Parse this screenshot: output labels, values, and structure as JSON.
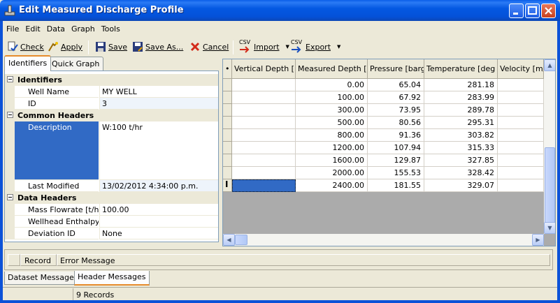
{
  "window": {
    "title": "Edit Measured Discharge Profile"
  },
  "menu": [
    "File",
    "Edit",
    "Data",
    "Graph",
    "Tools"
  ],
  "toolbar": {
    "check": "Check",
    "apply": "Apply",
    "save": "Save",
    "save_as": "Save As...",
    "cancel": "Cancel",
    "import": "Import",
    "export": "Export",
    "csv": "CSV"
  },
  "left_tabs": [
    "Identifiers",
    "Quick Graph"
  ],
  "properties": {
    "identifiers": {
      "label": "Identifiers",
      "well_name_label": "Well Name",
      "well_name": "MY WELL",
      "id_label": "ID",
      "id": "3"
    },
    "common": {
      "label": "Common Headers",
      "description_label": "Description",
      "description": "W:100 t/hr",
      "last_modified_label": "Last Modified",
      "last_modified": "13/02/2012 4:34:00 p.m."
    },
    "data_headers": {
      "label": "Data Headers",
      "mass_flowrate_label": "Mass Flowrate [t/hr",
      "mass_flowrate": "100.00",
      "wellhead_enthalpy_label": "Wellhead Enthalpy [",
      "wellhead_enthalpy": "",
      "deviation_label": "Deviation ID",
      "deviation": "None"
    }
  },
  "grid": {
    "row_marker": "•",
    "columns": [
      "Vertical Depth [m]",
      "Measured Depth [m]",
      "Pressure [barg]",
      "Temperature [deg C]",
      "Velocity [m/s]"
    ],
    "rows": [
      [
        "",
        "0.00",
        "65.04",
        "281.18",
        ""
      ],
      [
        "",
        "100.00",
        "67.92",
        "283.99",
        ""
      ],
      [
        "",
        "300.00",
        "73.95",
        "289.78",
        ""
      ],
      [
        "",
        "500.00",
        "80.56",
        "295.31",
        ""
      ],
      [
        "",
        "800.00",
        "91.36",
        "303.82",
        ""
      ],
      [
        "",
        "1200.00",
        "107.94",
        "315.33",
        ""
      ],
      [
        "",
        "1600.00",
        "129.87",
        "327.85",
        ""
      ],
      [
        "",
        "2000.00",
        "155.53",
        "328.42",
        ""
      ],
      [
        "",
        "2400.00",
        "181.55",
        "329.07",
        ""
      ]
    ],
    "editing_marker": "I"
  },
  "messages": {
    "col_record": "Record",
    "col_error": "Error Message"
  },
  "bottom_tabs": [
    "Dataset Messages",
    "Header Messages"
  ],
  "status": {
    "records": "9 Records"
  },
  "colors": {
    "title_bar": "#0458e2",
    "selection": "#316ac5"
  }
}
